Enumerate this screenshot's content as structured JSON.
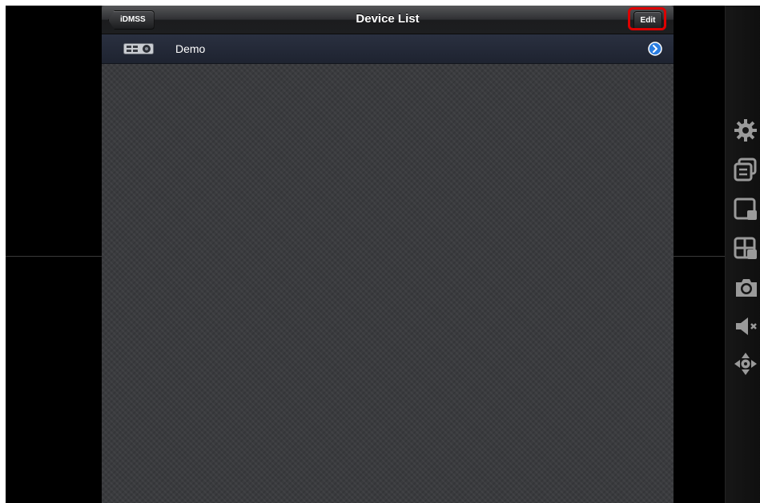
{
  "navbar": {
    "title": "Device List",
    "back_label": "iDMSS",
    "edit_label": "Edit"
  },
  "devices": [
    {
      "name": "Demo",
      "icon": "dvr-device-icon"
    }
  ],
  "toolbar_icons": [
    "gear-icon",
    "switch-window-icon",
    "single-view-icon",
    "grid-view-icon",
    "camera-snapshot-icon",
    "mute-icon",
    "ptz-direction-icon"
  ],
  "colors": {
    "highlight": "#dd0000",
    "disclosure": "#2a7de1"
  }
}
